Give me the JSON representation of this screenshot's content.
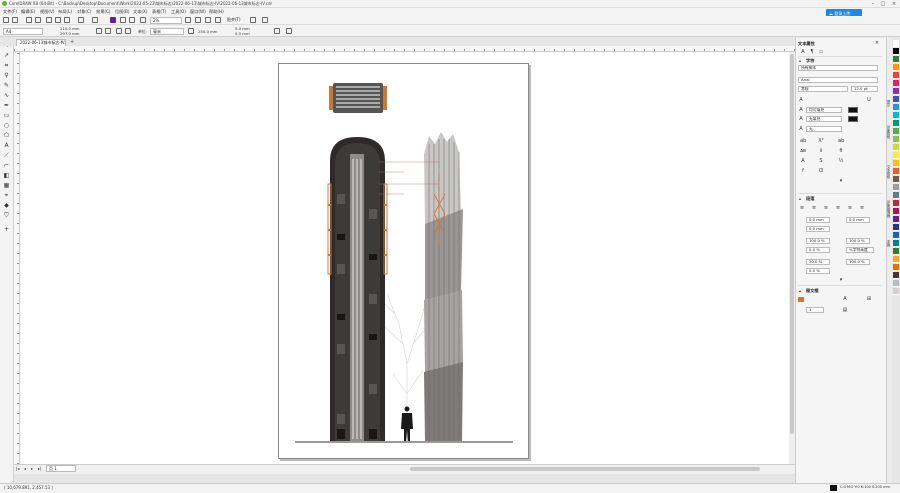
{
  "app": {
    "title": "CorelDRAW X8 (64-Bit) - C:\\Backup\\Desktop\\Document\\Work\\2023-05-23\\城市标志\\2022-06-13\\城市标志-IV\\2022-06-13城市标志-IV.cdr"
  },
  "menu": {
    "items": [
      "文件(F)",
      "编辑(E)",
      "视图(V)",
      "布局(L)",
      "对象(C)",
      "效果(C)",
      "位图(B)",
      "文本(X)",
      "表格(T)",
      "工具(O)",
      "窗口(W)",
      "帮助(H)"
    ],
    "cloud_button": "登录上传"
  },
  "toolbar": {
    "zoom": "2%",
    "snap": "贴齐(T)"
  },
  "propbar": {
    "paper_size": "A4",
    "width": "210.0 mm",
    "height": "297.0 mm",
    "units_label": "单位:",
    "units": "毫米",
    "nudge": "250.0 mm",
    "dup_x": "5.0 mm",
    "dup_y": "5.0 mm"
  },
  "tabs": {
    "document": "2022-06-13城市标志-IV.cdr",
    "close": "×",
    "add": "+"
  },
  "pagenav": {
    "page_label": "页 1"
  },
  "status": {
    "coords": "( 10,679.891, 2,457.53 )",
    "fill_info": "C:0 M:0 Y:0 K:100  0.200 mm"
  },
  "docker": {
    "title": "文本属性",
    "char_section": "字符",
    "script": "所有脚本",
    "font": "Arial",
    "style": "常规",
    "size": "12.0 pt",
    "fill_label": "均匀填充",
    "bg_label": "无填充",
    "outline_label": "无",
    "para_section": "段落",
    "indent_left": "0.0 mm",
    "indent_first": "0.0 mm",
    "indent_right": "0.0 mm",
    "line_spacing": "100.0 %",
    "spacing_unit": "%字符高度",
    "before_para": "100.0 %",
    "after_para": "0.0 %",
    "char_spacing": "20.0 %",
    "word_spacing": "100.0 %",
    "lang_spacing": "0.0 %",
    "frame_section": "图文框",
    "columns": "1"
  },
  "sidetabs": [
    "提示",
    "对象属性",
    "文本属性",
    "对象管理器",
    "变换"
  ],
  "colors": {
    "accent": "#1e88e5",
    "tower_dark": "#3a3636",
    "tower_light": "#8c8a8a",
    "accent_orange": "#c8783c",
    "palette": [
      "#ffffff",
      "#000000",
      "#2e7d32",
      "#ff9800",
      "#f44336",
      "#e91e63",
      "#9c27b0",
      "#3f51b5",
      "#2196f3",
      "#00bcd4",
      "#009688",
      "#4caf50",
      "#8bc34a",
      "#cddc39",
      "#ffeb3b",
      "#ffc107",
      "#ff5722",
      "#795548",
      "#9e9e9e",
      "#607d8b",
      "#c62828",
      "#ad1457",
      "#6a1b9a",
      "#283593",
      "#1565c0",
      "#00838f",
      "#2e7d32",
      "#f9a825",
      "#ef6c00",
      "#4e342e",
      "#b0bec5",
      "#d7ccc8"
    ]
  }
}
